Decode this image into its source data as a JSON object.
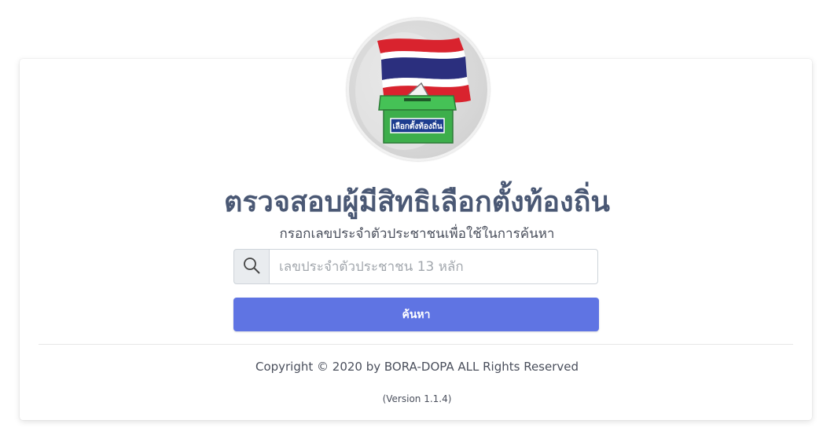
{
  "header": {
    "logo_text": "เลือกตั้งท้องถิ่น",
    "title": "ตรวจสอบผู้มีสิทธิเลือกตั้งท้องถิ่น",
    "subtitle": "กรอกเลขประจำตัวประชาชนเพื่อใช้ในการค้นหา"
  },
  "search": {
    "icon": "search-icon",
    "placeholder": "เลขประจำตัวประชาชน 13 หลัก",
    "value": "",
    "button_label": "ค้นหา"
  },
  "footer": {
    "copyright": "Copyright © 2020 by BORA-DOPA ALL Rights Reserved",
    "version": "(Version 1.1.4)"
  },
  "colors": {
    "primary_button": "#5f74e3",
    "title": "#4a5874",
    "flag_red": "#d9232e",
    "flag_blue": "#2b2f7e",
    "ballot_box_green": "#3dae4b"
  }
}
